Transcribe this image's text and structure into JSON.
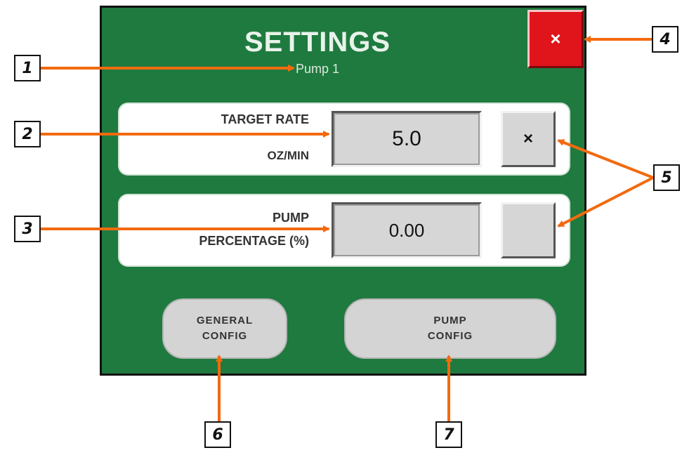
{
  "header": {
    "title": "SETTINGS",
    "subtitle": "Pump 1",
    "close_label": "×"
  },
  "rows": [
    {
      "label_line1": "TARGET RATE",
      "label_line2": "OZ/MIN",
      "value": "5.0",
      "checkbox": "×"
    },
    {
      "label_line1": "PUMP",
      "label_line2": "PERCENTAGE (%)",
      "value": "0.00",
      "checkbox": ""
    }
  ],
  "buttons": {
    "general_line1": "GENERAL",
    "general_line2": "CONFIG",
    "pump_line1": "PUMP",
    "pump_line2": "CONFIG"
  },
  "callouts": [
    "1",
    "2",
    "3",
    "4",
    "5",
    "6",
    "7"
  ],
  "colors": {
    "panel": "#1f7a3f",
    "close": "#e0141b",
    "arrow": "#f26a0f",
    "field": "#d6d6d6"
  }
}
